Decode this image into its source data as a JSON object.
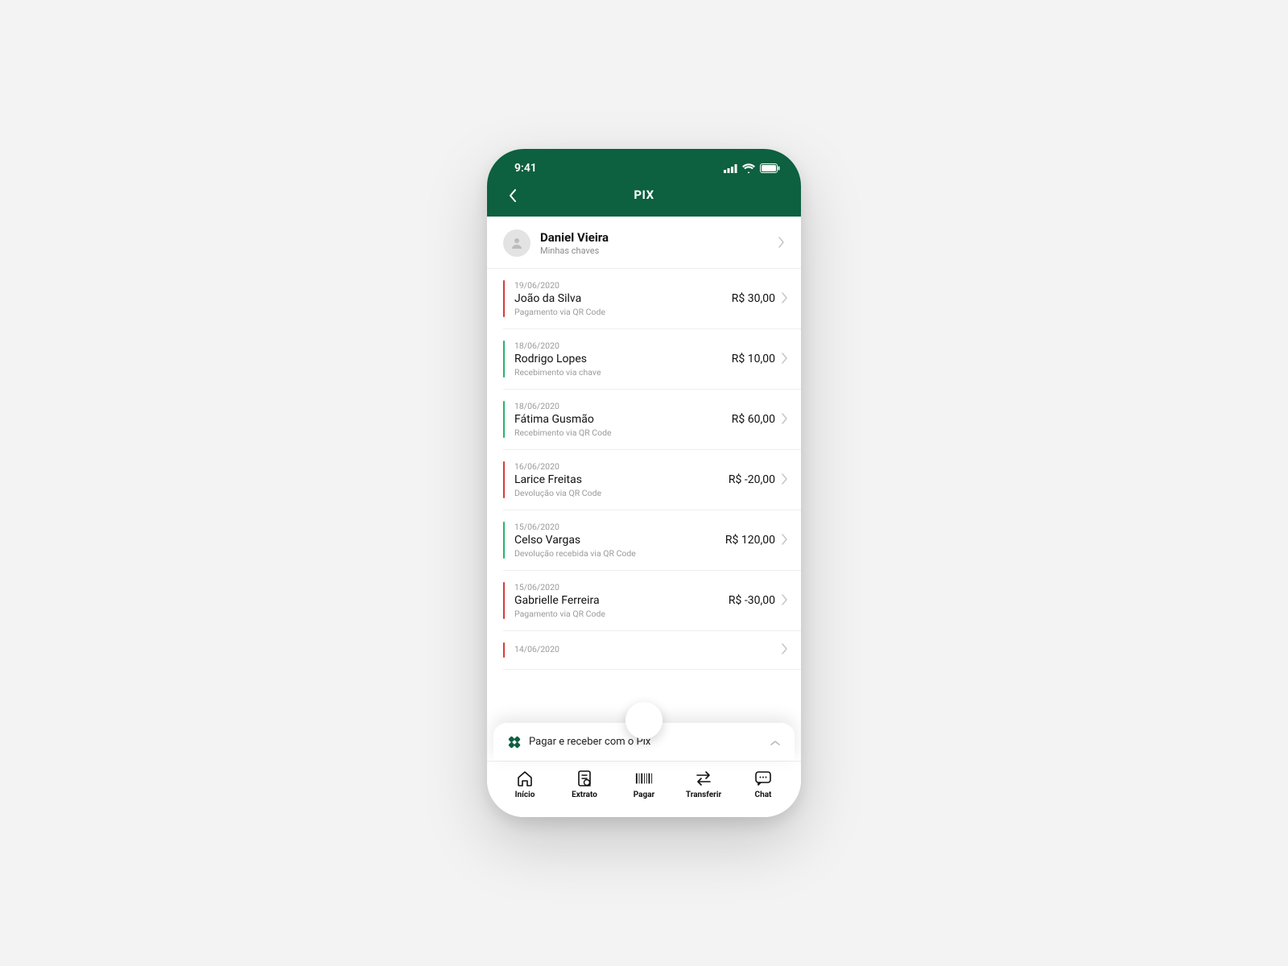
{
  "status": {
    "time": "9:41"
  },
  "header": {
    "title": "PIX"
  },
  "profile": {
    "name": "Daniel Vieira",
    "sub": "Minhas chaves"
  },
  "transactions": [
    {
      "date": "19/06/2020",
      "name": "João da Silva",
      "desc": "Pagamento via QR Code",
      "amount": "R$ 30,00",
      "color": "red"
    },
    {
      "date": "18/06/2020",
      "name": "Rodrigo Lopes",
      "desc": "Recebimento via chave",
      "amount": "R$ 10,00",
      "color": "green"
    },
    {
      "date": "18/06/2020",
      "name": "Fátima Gusmão",
      "desc": "Recebimento via QR Code",
      "amount": "R$ 60,00",
      "color": "green"
    },
    {
      "date": "16/06/2020",
      "name": "Larice Freitas",
      "desc": "Devolução via QR Code",
      "amount": "R$ -20,00",
      "color": "red"
    },
    {
      "date": "15/06/2020",
      "name": "Celso Vargas",
      "desc": "Devolução recebida via QR Code",
      "amount": "R$ 120,00",
      "color": "green"
    },
    {
      "date": "15/06/2020",
      "name": "Gabrielle Ferreira",
      "desc": "Pagamento via QR Code",
      "amount": "R$ -30,00",
      "color": "red"
    },
    {
      "date": "14/06/2020",
      "name": "",
      "desc": "",
      "amount": "",
      "color": "red"
    }
  ],
  "banner": {
    "label": "Pagar e receber com o Pix"
  },
  "tabs": [
    {
      "label": "Início"
    },
    {
      "label": "Extrato"
    },
    {
      "label": "Pagar"
    },
    {
      "label": "Transferir"
    },
    {
      "label": "Chat"
    }
  ]
}
